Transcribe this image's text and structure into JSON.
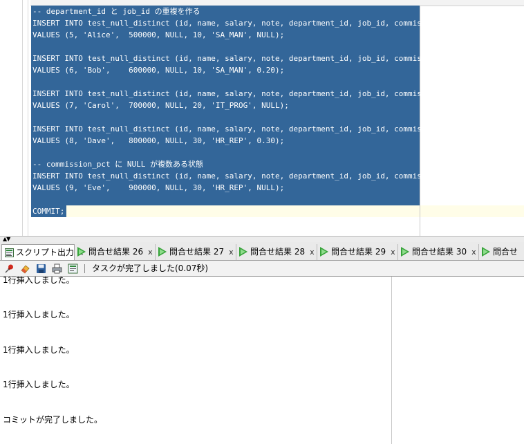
{
  "editor": {
    "lines": [
      "-- department_id と job_id の重複を作る",
      "INSERT INTO test_null_distinct (id, name, salary, note, department_id, job_id, commission_pct)",
      "VALUES (5, 'Alice',  500000, NULL, 10, 'SA_MAN', NULL);",
      "",
      "INSERT INTO test_null_distinct (id, name, salary, note, department_id, job_id, commission_pct)",
      "VALUES (6, 'Bob',    600000, NULL, 10, 'SA_MAN', 0.20);",
      "",
      "INSERT INTO test_null_distinct (id, name, salary, note, department_id, job_id, commission_pct)",
      "VALUES (7, 'Carol',  700000, NULL, 20, 'IT_PROG', NULL);",
      "",
      "INSERT INTO test_null_distinct (id, name, salary, note, department_id, job_id, commission_pct)",
      "VALUES (8, 'Dave',   800000, NULL, 30, 'HR_REP', 0.30);",
      "",
      "-- commission_pct に NULL が複数ある状態",
      "INSERT INTO test_null_distinct (id, name, salary, note, department_id, job_id, commission_pct)",
      "VALUES (9, 'Eve',    900000, NULL, 30, 'HR_REP', NULL);",
      "",
      "COMMIT;"
    ]
  },
  "tabs": [
    {
      "label": "スクリプト出力",
      "close": "x",
      "icon": "script-output-icon"
    },
    {
      "label": "問合せ結果 26",
      "close": "x",
      "icon": "run-query-icon"
    },
    {
      "label": "問合せ結果 27",
      "close": "x",
      "icon": "run-query-icon"
    },
    {
      "label": "問合せ結果 28",
      "close": "x",
      "icon": "run-query-icon"
    },
    {
      "label": "問合せ結果 29",
      "close": "x",
      "icon": "run-query-icon"
    },
    {
      "label": "問合せ結果 30",
      "close": "x",
      "icon": "run-query-icon"
    },
    {
      "label": "問合せ",
      "close": "",
      "icon": "run-query-icon"
    }
  ],
  "toolbar": {
    "status": "タスクが完了しました(0.07秒)"
  },
  "output": {
    "lines": [
      "1行挿入しました。",
      "1行挿入しました。",
      "1行挿入しました。",
      "1行挿入しました。",
      "コミットが完了しました。"
    ]
  },
  "colors": {
    "selection": "#336699",
    "current_line": "#fffde8",
    "run_green": "#37a33a"
  }
}
